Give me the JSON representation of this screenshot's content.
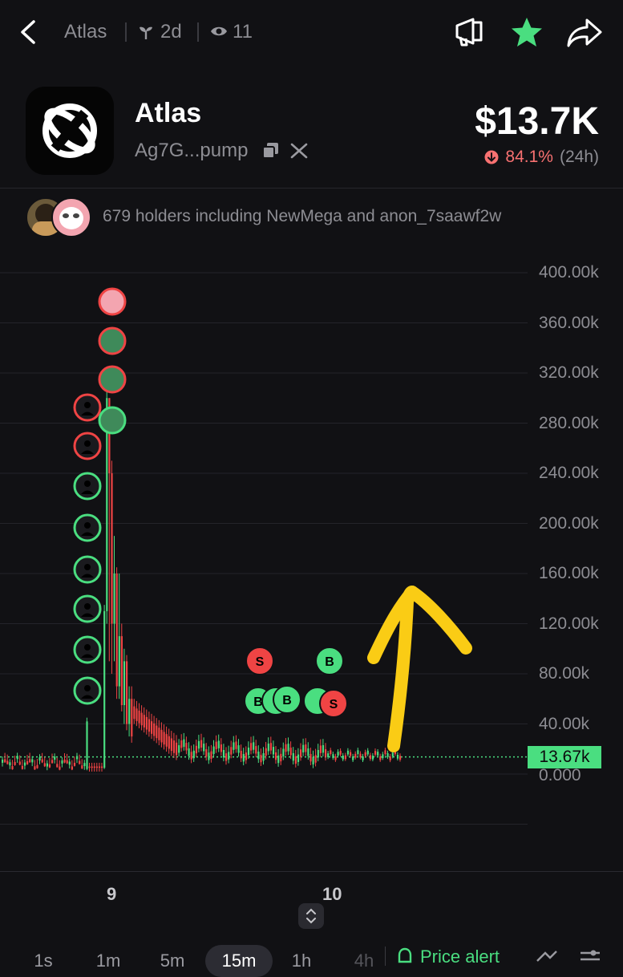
{
  "header": {
    "back_icon": "chevron-left-icon",
    "title": "Atlas",
    "age_icon": "sprout-icon",
    "age": "2d",
    "views_icon": "eye-icon",
    "views": "11",
    "actions": [
      "megaphone-icon",
      "star-icon",
      "share-icon"
    ],
    "accent": "#4ade80"
  },
  "token": {
    "name": "Atlas",
    "address": "Ag7G...pump",
    "copy_icon": "copy-icon",
    "x_icon": "x-logo-icon",
    "price": "$13.7K",
    "change": "84.1%",
    "change_period": "(24h)",
    "change_color": "#f87171"
  },
  "holders": {
    "text": "679 holders including NewMega and anon_7saawf2w"
  },
  "chart_data": {
    "type": "candlestick",
    "y_ticks": [
      "400.00k",
      "360.00k",
      "320.00k",
      "280.00k",
      "240.00k",
      "200.00k",
      "160.00k",
      "120.00k",
      "80.00k",
      "40.00k",
      "0.000"
    ],
    "ylim": [
      0,
      400000
    ],
    "x_ticks": [
      "9",
      "10"
    ],
    "current_price_label": "13.67k",
    "current_price": 13670,
    "up_color": "#4ade80",
    "down_color": "#ef4444",
    "trade_markers": [
      "B",
      "S",
      "B",
      "B",
      "S"
    ]
  },
  "controls": {
    "expand_icon": "up-down-chevron-icon",
    "timeframes": [
      "1s",
      "1m",
      "5m",
      "15m",
      "1h",
      "4h"
    ],
    "selected_timeframe": "15m",
    "price_alert": "Price alert",
    "alert_icon": "bell-icon"
  }
}
